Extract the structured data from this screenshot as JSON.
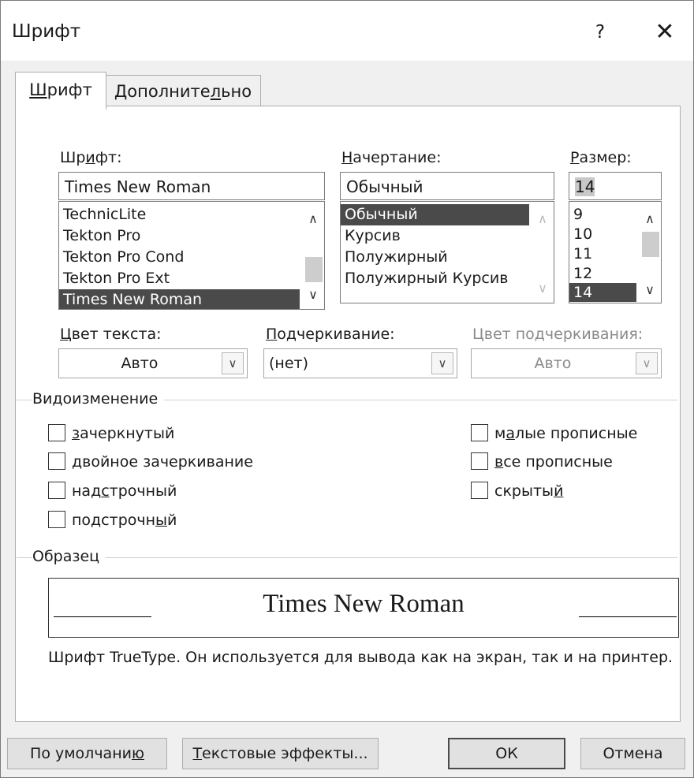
{
  "window": {
    "title": "Шрифт",
    "help_label": "?",
    "close_label": "✕"
  },
  "tabs": [
    {
      "label_pre": "",
      "label_ul": "Ш",
      "label_post": "рифт",
      "active": true
    },
    {
      "label_pre": "Дополните",
      "label_ul": "л",
      "label_post": "ьно",
      "active": false
    }
  ],
  "font": {
    "label_pre": "Шр",
    "label_ul": "и",
    "label_post": "фт:",
    "value": "Times New Roman",
    "items": [
      "TechnicLite",
      "Tekton Pro",
      "Tekton Pro Cond",
      "Tekton Pro Ext",
      "Times New Roman"
    ],
    "selected": "Times New Roman"
  },
  "style": {
    "label_pre": "",
    "label_ul": "Н",
    "label_post": "ачертание:",
    "value": "Обычный",
    "items": [
      "Обычный",
      "Курсив",
      "Полужирный",
      "Полужирный Курсив"
    ],
    "selected": "Обычный"
  },
  "size": {
    "label_pre": "",
    "label_ul": "Р",
    "label_post": "азмер:",
    "value": "14",
    "items": [
      "9",
      "10",
      "11",
      "12",
      "14"
    ],
    "selected": "14"
  },
  "text_color": {
    "label_pre": "",
    "label_ul": "Ц",
    "label_post": "вет текста:",
    "value": "Авто"
  },
  "underline": {
    "label_pre": "",
    "label_ul": "П",
    "label_post": "одчеркивание:",
    "value": "(нет)"
  },
  "underline_color": {
    "label": "Цвет подчеркивания:",
    "value": "Авто"
  },
  "effects": {
    "title": "Видоизменение",
    "left": [
      {
        "pre": "",
        "ul": "з",
        "post": "ачеркнутый"
      },
      {
        "pre": "",
        "ul": "д",
        "post": "войное зачеркивание"
      },
      {
        "pre": "над",
        "ul": "с",
        "post": "трочный"
      },
      {
        "pre": "подстрочн",
        "ul": "ы",
        "post": "й"
      }
    ],
    "right": [
      {
        "pre": "м",
        "ul": "а",
        "post": "лые прописные"
      },
      {
        "pre": "",
        "ul": "в",
        "post": "се прописные"
      },
      {
        "pre": "скрыты",
        "ul": "й",
        "post": ""
      }
    ]
  },
  "preview": {
    "title": "Образец",
    "sample_text": "Times New Roman",
    "note": "Шрифт TrueType. Он используется для вывода как на экран, так и на принтер."
  },
  "buttons": {
    "default": {
      "pre": "По умолчани",
      "ul": "ю",
      "post": ""
    },
    "text_effects": {
      "pre": "",
      "ul": "Т",
      "post": "екстовые эффекты..."
    },
    "ok": "ОК",
    "cancel": "Отмена"
  }
}
